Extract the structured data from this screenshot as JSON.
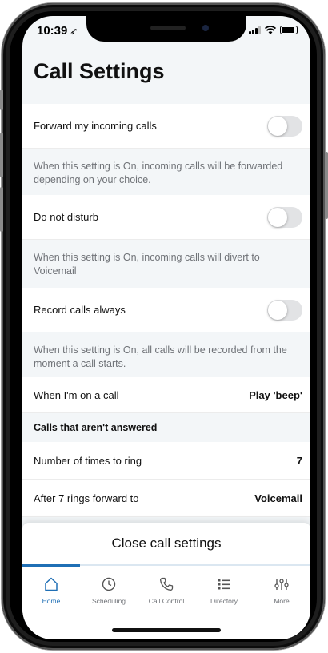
{
  "status_bar": {
    "time": "10:39",
    "location_icon": "location-arrow-icon"
  },
  "page": {
    "title": "Call Settings"
  },
  "settings": [
    {
      "label": "Forward my incoming calls",
      "toggle": false,
      "description": "When this setting is On, incoming calls will be forwarded depending on your choice."
    },
    {
      "label": "Do not disturb",
      "toggle": false,
      "description": "When this setting is On, incoming calls will divert to Voicemail"
    },
    {
      "label": "Record calls always",
      "toggle": false,
      "description": "When this setting is On, all calls will be recorded from the moment a call starts."
    }
  ],
  "on_call": {
    "label": "When I'm on a call",
    "value": "Play 'beep'"
  },
  "unanswered": {
    "heading": "Calls that aren't answered",
    "ring_count": {
      "label": "Number of times to ring",
      "value": "7"
    },
    "forward_to": {
      "label": "After 7 rings forward to",
      "value": "Voicemail"
    }
  },
  "close_button": {
    "label": "Close call settings"
  },
  "tabs": [
    {
      "label": "Home",
      "icon": "home-icon",
      "active": true
    },
    {
      "label": "Scheduling",
      "icon": "clock-icon",
      "active": false
    },
    {
      "label": "Call Control",
      "icon": "phone-icon",
      "active": false
    },
    {
      "label": "Directory",
      "icon": "list-icon",
      "active": false
    },
    {
      "label": "More",
      "icon": "sliders-icon",
      "active": false
    }
  ],
  "colors": {
    "accent": "#1f6fb5",
    "background": "#f3f6f8",
    "toggle_off": "#e2e3e5"
  }
}
